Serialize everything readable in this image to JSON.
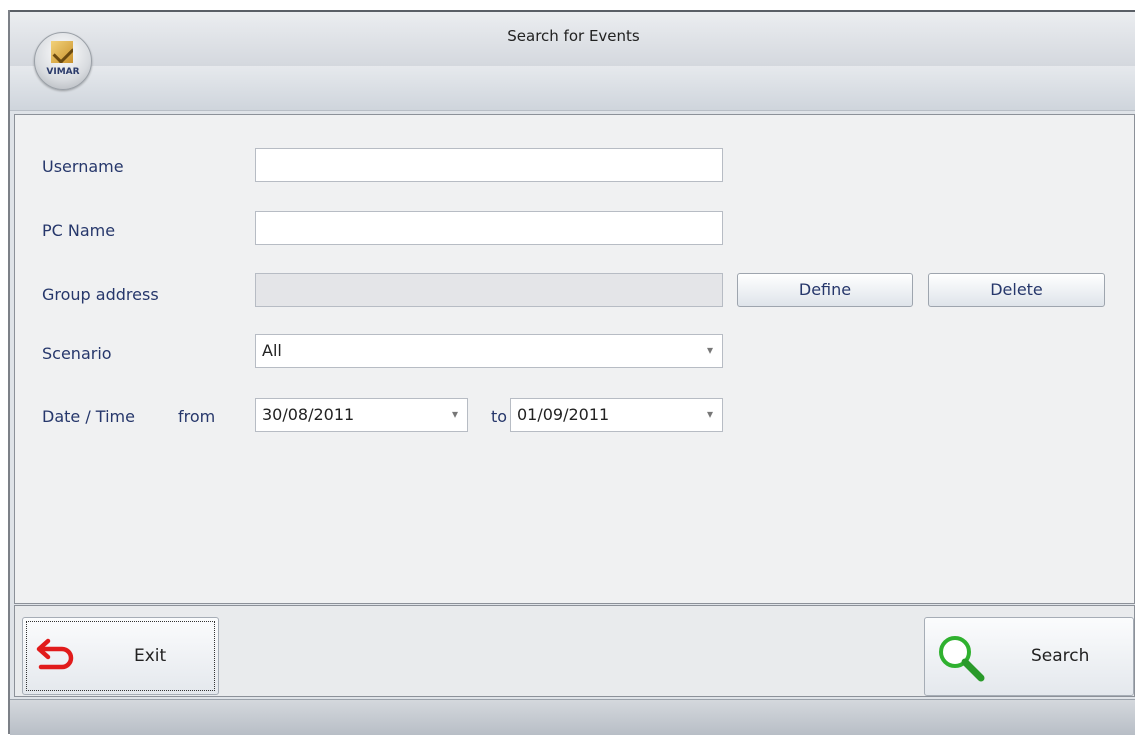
{
  "window": {
    "title": "Search for Events"
  },
  "logo": {
    "text": "VIMAR"
  },
  "form": {
    "username": {
      "label": "Username",
      "value": ""
    },
    "pc_name": {
      "label": "PC Name",
      "value": ""
    },
    "group_address": {
      "label": "Group address",
      "value": "",
      "define_label": "Define",
      "delete_label": "Delete"
    },
    "scenario": {
      "label": "Scenario",
      "value": "All"
    },
    "date_time": {
      "label": "Date / Time",
      "from_label": "from",
      "from_value": "30/08/2011",
      "to_label": "to",
      "to_value": "01/09/2011"
    }
  },
  "footer": {
    "exit_label": "Exit",
    "search_label": "Search"
  },
  "colors": {
    "label_text": "#26376b",
    "exit_icon": "#e11b1b",
    "search_icon": "#2fb12f"
  }
}
